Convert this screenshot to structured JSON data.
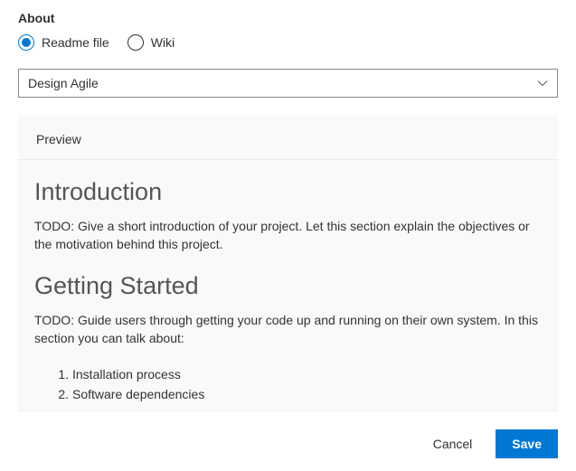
{
  "section_title": "About",
  "radio": {
    "readme_label": "Readme file",
    "wiki_label": "Wiki"
  },
  "dropdown": {
    "selected": "Design Agile"
  },
  "tab": {
    "preview_label": "Preview"
  },
  "content": {
    "intro_heading": "Introduction",
    "intro_body": "TODO: Give a short introduction of your project. Let this section explain the objectives or the motivation behind this project.",
    "getting_started_heading": "Getting Started",
    "getting_started_body": "TODO: Guide users through getting your code up and running on their own system. In this section you can talk about:",
    "list_item_1": "Installation process",
    "list_item_2": "Software dependencies"
  },
  "footer": {
    "cancel_label": "Cancel",
    "save_label": "Save"
  }
}
